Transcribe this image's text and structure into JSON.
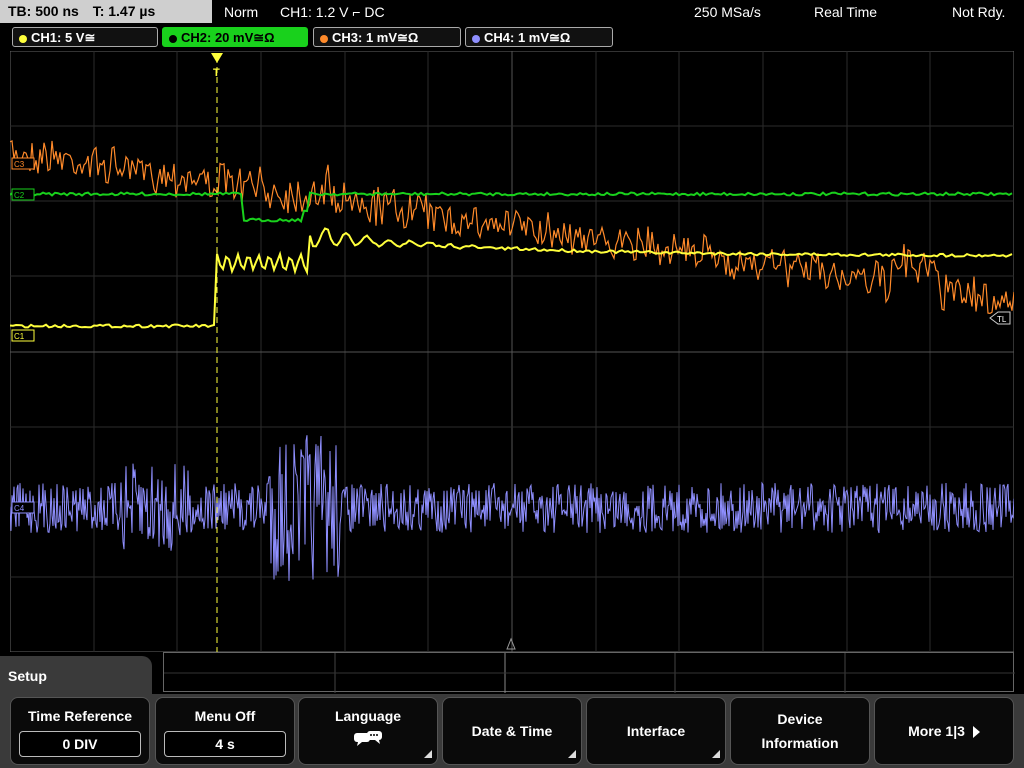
{
  "header": {
    "timebase": "TB: 500 ns",
    "trigger_time": "T: 1.47 µs",
    "mode": "Norm",
    "trigger_source": "CH1: 1.2 V ⌐ DC",
    "sample_rate": "250 MSa/s",
    "acq_mode": "Real Time",
    "status": "Not Rdy."
  },
  "channels": [
    {
      "label": "CH1: 5 V≅",
      "color": "#ffff3c"
    },
    {
      "label": "CH2: 20 mV≅Ω",
      "color": "#19d11c"
    },
    {
      "label": "CH3: 1 mV≅Ω",
      "color": "#ff8a2a"
    },
    {
      "label": "CH4: 1 mV≅Ω",
      "color": "#8f8fff"
    }
  ],
  "markers": {
    "c1": "C1",
    "c2": "C2",
    "c3": "C3",
    "c4": "C4",
    "trigger_level": "TL",
    "trigger_pos": "T"
  },
  "menu": {
    "title": "Setup",
    "keys": [
      {
        "label": "Time Reference",
        "value": "0 DIV"
      },
      {
        "label": "Menu Off",
        "value": "4 s"
      },
      {
        "label": "Language",
        "icon": "speech-bubbles-icon"
      },
      {
        "label": "Date & Time"
      },
      {
        "label": "Interface"
      },
      {
        "label1": "Device",
        "label2": "Information"
      },
      {
        "label": "More 1|3"
      }
    ]
  }
}
